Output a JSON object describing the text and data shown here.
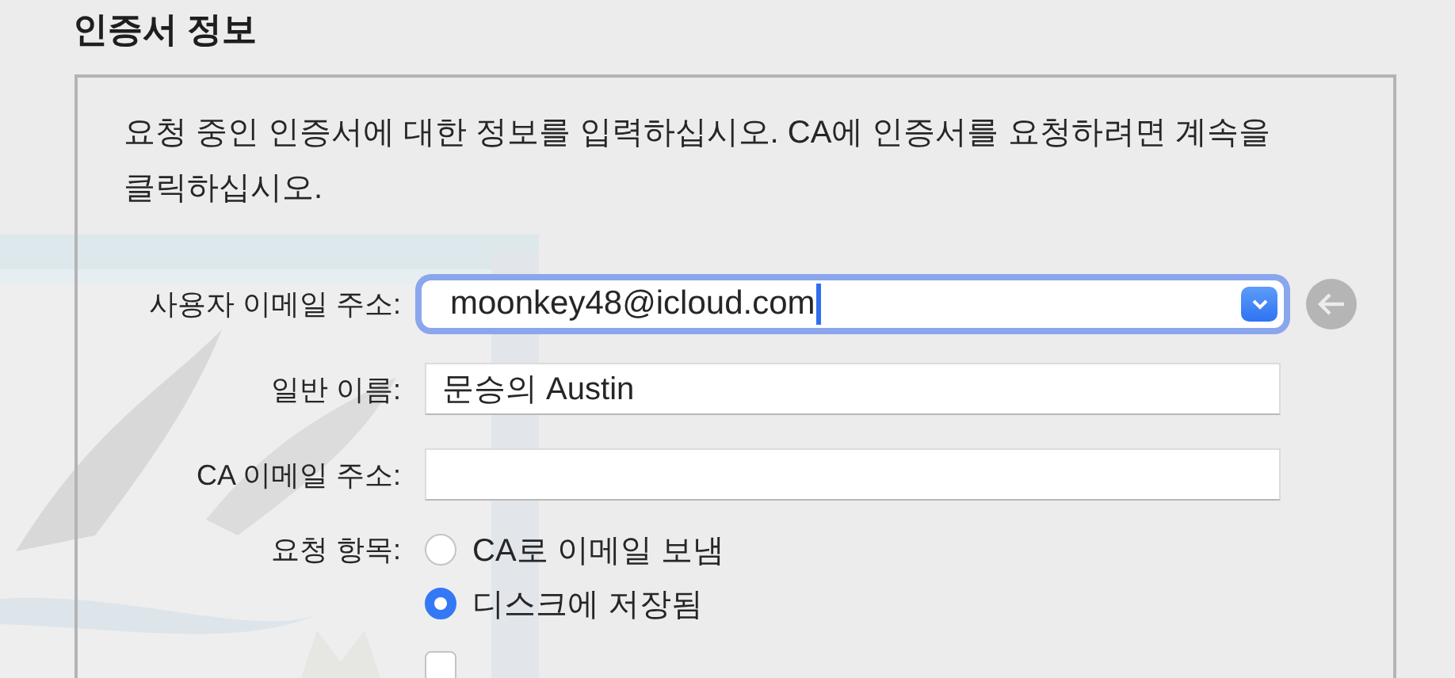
{
  "title": "인증서 정보",
  "intro": "요청 중인 인증서에 대한 정보를 입력하십시오. CA에 인증서를 요청하려면 계속을 클릭하십시오.",
  "fields": [
    {
      "kind": "combo",
      "label": "사용자 이메일 주소:",
      "value": "moonkey48@icloud.com",
      "focused": true
    },
    {
      "kind": "text",
      "label": "일반 이름:",
      "value": "문승의 Austin",
      "focused": false
    },
    {
      "kind": "text",
      "label": "CA 이메일 주소:",
      "focused": false
    }
  ],
  "request": {
    "label": "요청 항목:",
    "options": [
      {
        "label": "CA로 이메일 보냄",
        "selected": false
      },
      {
        "label": "디스크에 저장됨",
        "selected": true
      }
    ]
  },
  "checkbox": {
    "checked": false
  }
}
